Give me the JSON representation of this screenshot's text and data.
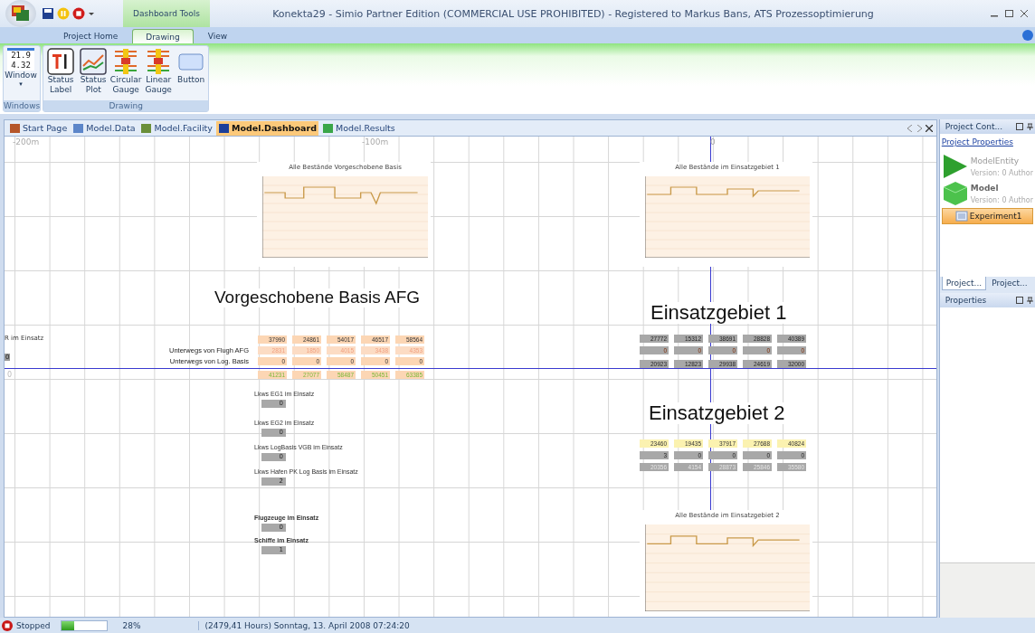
{
  "window": {
    "title": "Konekta29 - Simio Partner Edition (COMMERCIAL USE PROHIBITED) - Registered to Markus Bans, ATS Prozessoptimierung",
    "context_tab": "Dashboard Tools"
  },
  "ribbon_tabs": [
    {
      "label": "Project Home",
      "selected": false
    },
    {
      "label": "Drawing",
      "selected": true
    },
    {
      "label": "View",
      "selected": false
    }
  ],
  "ribbon_groups": [
    {
      "label": "Windows",
      "buttons": [
        {
          "kind": "window",
          "label": "Window",
          "icon_text": [
            "21.9",
            "4.32"
          ],
          "caret": "▾"
        }
      ]
    },
    {
      "label": "Drawing",
      "buttons": [
        {
          "kind": "status-label",
          "label": "Status Label"
        },
        {
          "kind": "status-plot",
          "label": "Status Plot"
        },
        {
          "kind": "gauge",
          "label": "Circular Gauge"
        },
        {
          "kind": "gauge",
          "label": "Linear Gauge"
        },
        {
          "kind": "button",
          "label": "Button"
        }
      ]
    }
  ],
  "doc_tabs": [
    {
      "label": "Start Page",
      "selected": false
    },
    {
      "label": "Model.Data",
      "selected": false
    },
    {
      "label": "Model.Facility",
      "selected": false
    },
    {
      "label": "Model.Dashboard",
      "selected": true
    },
    {
      "label": "Model.Results",
      "selected": false
    }
  ],
  "canvas": {
    "axis_labels": [
      "-200m",
      "-100m",
      "0"
    ],
    "charts": [
      {
        "title": "Alle Bestände Vorgeschobene Basis"
      },
      {
        "title": "Alle Bestände im Einsatzgebiet 1"
      },
      {
        "title": "Alle Bestände im Einsatzgebiet 2"
      }
    ],
    "headings": [
      "Vorgeschobene Basis AFG",
      "Einsatzgebiet 1",
      "Einsatzgebiet 2"
    ],
    "edge": {
      "label": "R im Einsatz",
      "values": [
        "0",
        "0"
      ]
    },
    "blocks": [
      {
        "rows": [
          {
            "kind": "peach",
            "values": [
              "37990",
              "24861",
              "54017",
              "46517",
              "58564"
            ]
          },
          {
            "kind": "peach-faint",
            "label": "Unterwegs von Flugh AFG",
            "values": [
              "2831",
              "1850",
              "4015",
              "3438",
              "4353"
            ]
          },
          {
            "kind": "peach",
            "label": "Unterwegs von Log. Basis",
            "values": [
              "0",
              "0",
              "0",
              "0",
              "0"
            ]
          },
          {
            "kind": "green",
            "values": [
              "41231",
              "27077",
              "58487",
              "50451",
              "63385"
            ]
          }
        ]
      },
      {
        "rows": [
          {
            "kind": "grey",
            "values": [
              "27772",
              "15312",
              "38691",
              "28828",
              "40389"
            ]
          },
          {
            "kind": "grey-orange",
            "values": [
              "0",
              "0",
              "0",
              "0",
              "0"
            ]
          },
          {
            "kind": "grey",
            "values": [
              "20923",
              "12823",
              "29938",
              "24619",
              "32000"
            ]
          }
        ]
      },
      {
        "rows": [
          {
            "kind": "yellow",
            "values": [
              "23460",
              "19435",
              "37917",
              "27688",
              "40824"
            ]
          },
          {
            "kind": "grey",
            "values": [
              "3",
              "0",
              "0",
              "0",
              "0"
            ]
          },
          {
            "kind": "grey-faint",
            "values": [
              "20356",
              "4154",
              "28873",
              "25846",
              "35580"
            ]
          }
        ]
      }
    ],
    "counters": [
      {
        "label": "Lkws EG1 im Einsatz",
        "value": "0"
      },
      {
        "label": "Lkws EG2 im Einsatz",
        "value": "0"
      },
      {
        "label": "Lkws LogBasis VGB im Einsatz",
        "value": "0"
      },
      {
        "label": "Lkws Hafen PK Log Basis im Einsatz",
        "value": "2"
      },
      {
        "label": "Flugzeuge im Einsatz",
        "value": "0"
      },
      {
        "label": "Schiffe im Einsatz",
        "value": "1"
      }
    ]
  },
  "project_panel": {
    "title": "Project Cont...",
    "link": "Project Properties",
    "items": [
      {
        "kind": "entity",
        "name": "ModelEntity",
        "detail": "Version: 0 Author",
        "selected": false
      },
      {
        "kind": "model",
        "name": "Model",
        "detail": "Version: 0 Author",
        "selected": false
      },
      {
        "kind": "experiment",
        "name": "Experiment1",
        "selected": true
      }
    ],
    "tabs": [
      {
        "label": "Project...",
        "selected": true
      },
      {
        "label": "Project...",
        "selected": false
      }
    ]
  },
  "properties_panel": {
    "title": "Properties"
  },
  "status_bar": {
    "state": "Stopped",
    "progress": {
      "level": 0.28,
      "reading": "28%"
    },
    "time": "(2479,41 Hours) Sonntag, 13. April 2008 07:24:20"
  }
}
